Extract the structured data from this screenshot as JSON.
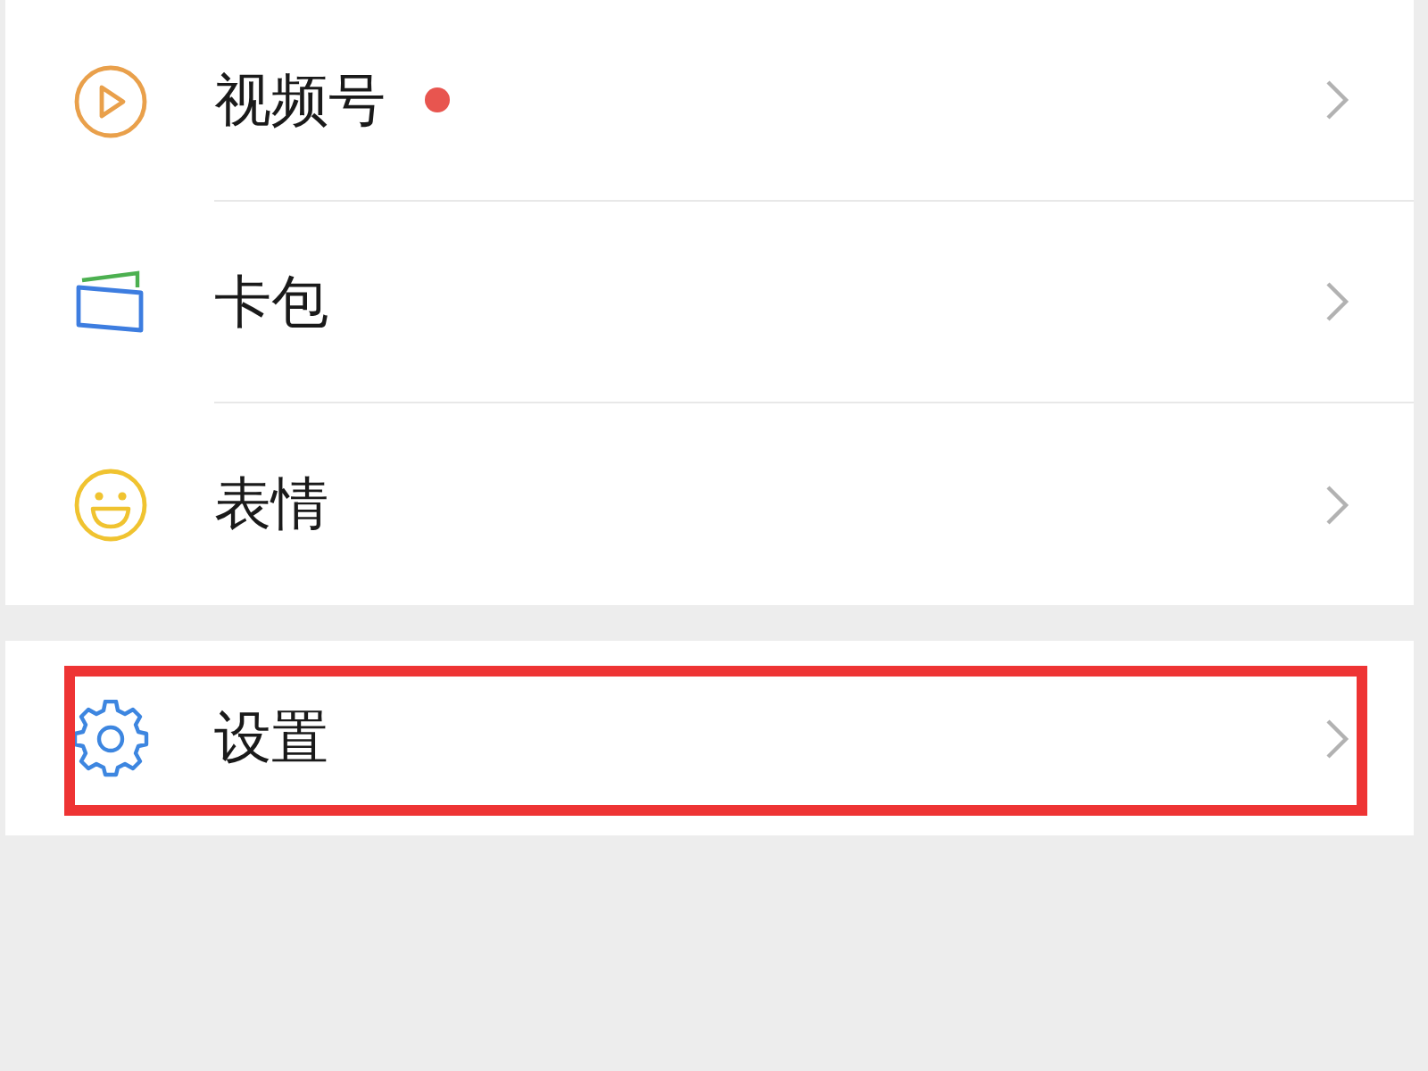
{
  "groups": [
    {
      "items": [
        {
          "kind": "channels",
          "label": "视频号",
          "dot": true,
          "highlighted": false
        },
        {
          "kind": "cards",
          "label": "卡包",
          "dot": false,
          "highlighted": false
        },
        {
          "kind": "stickers",
          "label": "表情",
          "dot": false,
          "highlighted": false
        }
      ]
    },
    {
      "items": [
        {
          "kind": "settings",
          "label": "设置",
          "dot": false,
          "highlighted": true
        }
      ]
    }
  ]
}
